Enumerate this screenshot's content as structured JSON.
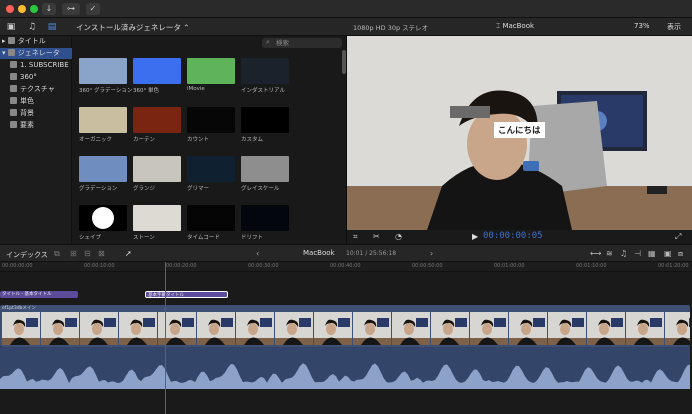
{
  "toolbar": {
    "import_icon": "download-arrow-icon",
    "key_label": "O",
    "check_icon": "checkmark-icon"
  },
  "browser": {
    "category_title": "インストール済みジェネレータ ⌃",
    "search_placeholder": "検索"
  },
  "sidebar": {
    "items": [
      {
        "label": "タイトル",
        "selected": false,
        "indent": 0
      },
      {
        "label": "ジェネレータ",
        "selected": true,
        "indent": 0
      },
      {
        "label": "1. SUBSCRIBE",
        "selected": false,
        "indent": 1
      },
      {
        "label": "360°",
        "selected": false,
        "indent": 1
      },
      {
        "label": "テクスチャ",
        "selected": false,
        "indent": 1
      },
      {
        "label": "単色",
        "selected": false,
        "indent": 1
      },
      {
        "label": "背景",
        "selected": false,
        "indent": 1
      },
      {
        "label": "要素",
        "selected": false,
        "indent": 1
      }
    ]
  },
  "generators": [
    {
      "label": "360° グラデーション",
      "color": "#8aa3c8"
    },
    {
      "label": "360° 単色",
      "color": "#3c6ff0"
    },
    {
      "label": "iMovie",
      "color": "#5fb35a"
    },
    {
      "label": "インダストリアル",
      "color": "#1c222b"
    },
    {
      "label": "オーガニック",
      "color": "#c9bfa0"
    },
    {
      "label": "カーテン",
      "color": "#7a2412"
    },
    {
      "label": "カウント",
      "color": "#060606"
    },
    {
      "label": "カスタム",
      "color": "#000000"
    },
    {
      "label": "グラデーション",
      "color": "#6f8dbf"
    },
    {
      "label": "グランジ",
      "color": "#c8c5bd"
    },
    {
      "label": "グリマー",
      "color": "#0f2030"
    },
    {
      "label": "グレイスケール",
      "color": "#8e8e8e"
    },
    {
      "label": "シェイプ",
      "color": "#000000"
    },
    {
      "label": "ストーン",
      "color": "#dcdad3"
    },
    {
      "label": "タイムコード",
      "color": "#050505"
    },
    {
      "label": "ドリフト",
      "color": "#03060c"
    }
  ],
  "viewer": {
    "format": "1080p HD 30p ステレオ",
    "library": "MacBook",
    "zoom": "73%",
    "view_menu": "表示",
    "caption": "こんにちは",
    "timecode": "00:00:00:05"
  },
  "timeline": {
    "index_label": "インデックス",
    "project": "MacBook",
    "duration": "10:01 / 25:56:18",
    "ruler_ticks": [
      "00:00:00:00",
      "00:00:10:00",
      "00:00:20:00",
      "00:00:30:00",
      "00:00:40:00",
      "00:00:50:00",
      "00:01:00:00",
      "00:01:10:00",
      "00:01:20:00"
    ],
    "title_clip": "タイトル - 基本タイトル",
    "caption_clip": "基本字幕タイトル",
    "video_clip": "ef1pt3dbメイン"
  }
}
